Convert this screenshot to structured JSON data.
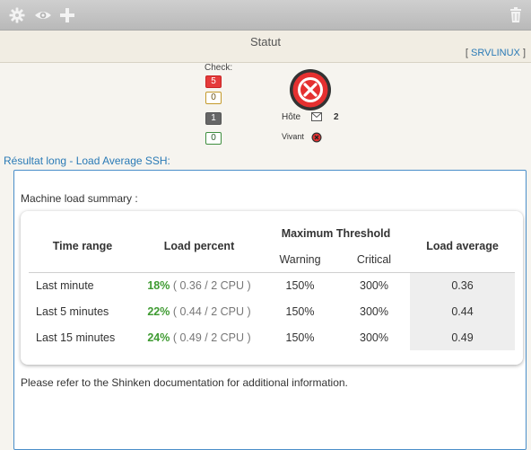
{
  "toolbar": {
    "settings_icon": "gear-icon",
    "view_icon": "eye-icon",
    "add_icon": "plus-icon",
    "delete_icon": "trash-icon"
  },
  "header": {
    "title": "Statut",
    "host_link": "SRVLINUX",
    "bracket_open": "[",
    "bracket_close": "]"
  },
  "check": {
    "label": "Check:",
    "counts": [
      "5",
      "0",
      "1",
      "0"
    ],
    "colors": [
      "#e53a3a",
      "#c49a2b",
      "#666666",
      "#3f8f3f"
    ]
  },
  "host": {
    "label": "Hôte",
    "count": "2",
    "alive_label": "Vivant",
    "state_color": "#e53a3a"
  },
  "result": {
    "section_title": "Résultat long - Load Average SSH:",
    "summary_title": "Machine load summary :",
    "columns": {
      "time_range": "Time range",
      "load_percent": "Load percent",
      "max_threshold": "Maximum Threshold",
      "warning": "Warning",
      "critical": "Critical",
      "load_average": "Load average"
    },
    "rows": [
      {
        "range": "Last minute",
        "pct": "18%",
        "detail": " ( 0.36 / 2 CPU )",
        "warning": "150%",
        "critical": "300%",
        "avg": "0.36"
      },
      {
        "range": "Last 5 minutes",
        "pct": "22%",
        "detail": " ( 0.44 / 2 CPU )",
        "warning": "150%",
        "critical": "300%",
        "avg": "0.44"
      },
      {
        "range": "Last 15 minutes",
        "pct": "24%",
        "detail": " ( 0.49 / 2 CPU )",
        "warning": "150%",
        "critical": "300%",
        "avg": "0.49"
      }
    ],
    "footer": "Please refer to the Shinken documentation for additional information."
  }
}
